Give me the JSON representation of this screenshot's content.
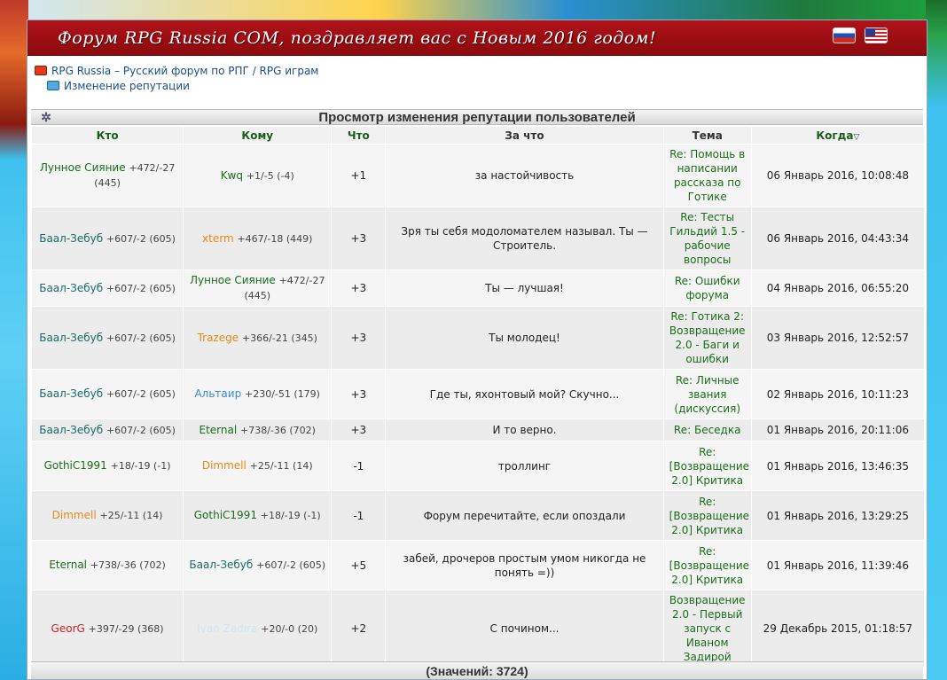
{
  "banner": {
    "title": "Форум RPG Russia COM, поздравляет вас с Новым 2016 годом!"
  },
  "breadcrumb": {
    "forum": "RPG Russia – Русский форум по РПГ / RPG играм",
    "page": "Изменение репутации"
  },
  "section": {
    "title": "Просмотр изменения репутации пользователей"
  },
  "columns": {
    "who": "Кто",
    "whom": "Кому",
    "what": "Что",
    "why": "За что",
    "topic": "Тема",
    "when": "Когда"
  },
  "rows": [
    {
      "from": "Лунное Сияние",
      "from_stat": "+472/-27 (445)",
      "to": "Kwq",
      "to_stat": "+1/-5 (-4)",
      "value": "+1",
      "reason": "за настойчивость",
      "topic": "Re: Помощь в написании рассказа по Готике",
      "date": "06 Январь 2016, 10:08:48"
    },
    {
      "from": "Баал-Зебуб",
      "from_stat": "+607/-2 (605)",
      "to": "xterm",
      "to_stat": "+467/-18 (449)",
      "value": "+3",
      "reason": "Зря ты себя модоломателем называл. Ты — Строитель.",
      "topic": "Re: Тесты Гильдий 1.5 - рабочие вопросы",
      "date": "06 Январь 2016, 04:43:34"
    },
    {
      "from": "Баал-Зебуб",
      "from_stat": "+607/-2 (605)",
      "to": "Лунное Сияние",
      "to_stat": "+472/-27 (445)",
      "value": "+3",
      "reason": "Ты — лучшая!",
      "topic": "Re: Ошибки форума",
      "date": "04 Январь 2016, 06:55:20"
    },
    {
      "from": "Баал-Зебуб",
      "from_stat": "+607/-2 (605)",
      "to": "Trazege",
      "to_stat": "+366/-21 (345)",
      "value": "+3",
      "reason": "Ты молодец!",
      "topic": "Re: Готика 2: Возвращение 2.0 - Баги и ошибки",
      "date": "03 Январь 2016, 12:52:57"
    },
    {
      "from": "Баал-Зебуб",
      "from_stat": "+607/-2 (605)",
      "to": "Альтаир",
      "to_stat": "+230/-51 (179)",
      "value": "+3",
      "reason": "Где ты, яхонтовый мой? Скучно...",
      "topic": "Re: Личные звания (дискуссия)",
      "date": "02 Январь 2016, 10:11:23"
    },
    {
      "from": "Баал-Зебуб",
      "from_stat": "+607/-2 (605)",
      "to": "Eternal",
      "to_stat": "+738/-36 (702)",
      "value": "+3",
      "reason": "И то верно.",
      "topic": "Re: Беседка",
      "date": "01 Январь 2016, 20:11:06"
    },
    {
      "from": "GothiC1991",
      "from_stat": "+18/-19 (-1)",
      "to": "Dimmell",
      "to_stat": "+25/-11 (14)",
      "value": "-1",
      "reason": "троллинг",
      "topic": "Re: [Возвращение 2.0] Критика",
      "date": "01 Январь 2016, 13:46:35"
    },
    {
      "from": "Dimmell",
      "from_stat": "+25/-11 (14)",
      "to": "GothiC1991",
      "to_stat": "+18/-19 (-1)",
      "value": "-1",
      "reason": "Форум перечитайте, если опоздали",
      "topic": "Re: [Возвращение 2.0] Критика",
      "date": "01 Январь 2016, 13:29:25"
    },
    {
      "from": "Eternal",
      "from_stat": "+738/-36 (702)",
      "to": "Баал-Зебуб",
      "to_stat": "+607/-2 (605)",
      "value": "+5",
      "reason": "забей, дрочеров простым умом никогда не понять =))",
      "topic": "Re: [Возвращение 2.0] Критика",
      "date": "01 Январь 2016, 11:39:46"
    },
    {
      "from": "GeorG",
      "from_stat": "+397/-29 (368)",
      "to": "Ivan Zadira",
      "to_stat": "+20/-0 (20)",
      "value": "+2",
      "reason": "С почином...",
      "topic": "Возвращение 2.0 - Первый запуск с Иваном Задирой",
      "date": "29 Декабрь 2015, 01:18:57"
    }
  ],
  "footer": {
    "total": "(Значений: 3724)"
  },
  "colors": {
    "banner": "#b01218",
    "user_green": "#1a6d1a",
    "user_orange": "#e58a16",
    "user_blue": "#3a88c8",
    "user_red": "#d02020"
  }
}
